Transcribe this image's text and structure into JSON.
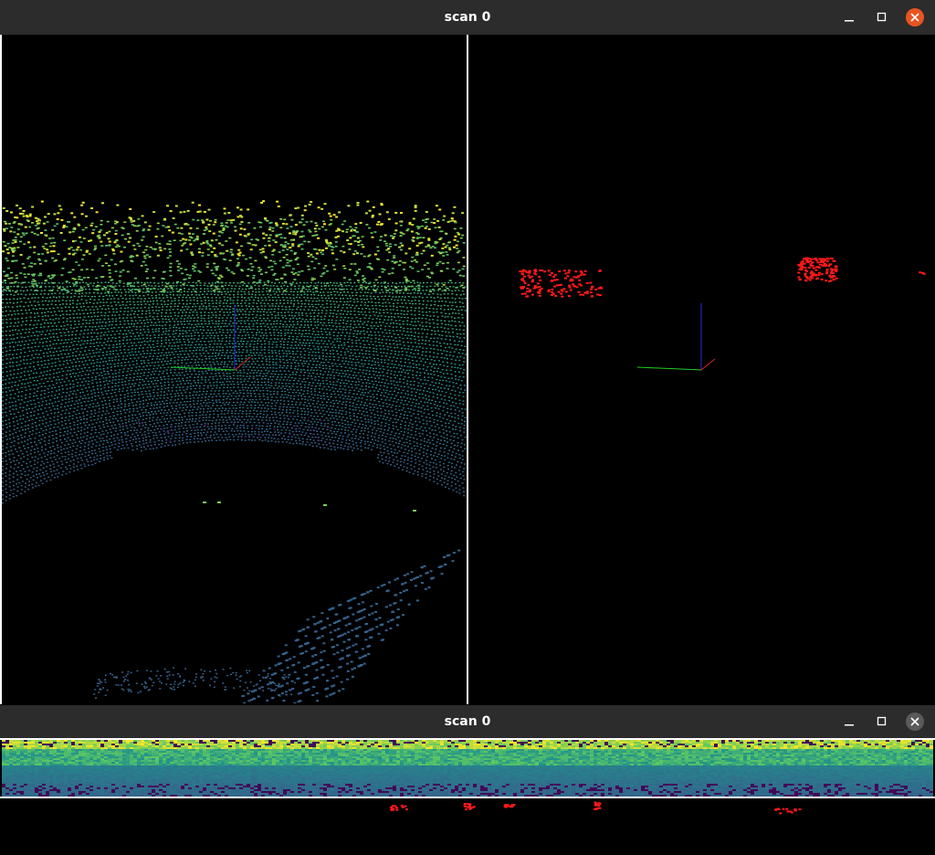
{
  "windows": [
    {
      "title": "scan 0",
      "controls": {
        "minimize": "minimize-icon",
        "maximize": "maximize-icon",
        "close": "close-icon"
      },
      "close_color": "#e95420",
      "views": {
        "left": "point-cloud-range-colored",
        "right": "point-cloud-label-colored"
      }
    },
    {
      "title": "scan 0",
      "controls": {
        "minimize": "minimize-icon",
        "maximize": "maximize-icon",
        "close": "close-icon"
      },
      "close_color": "#5a5a5a",
      "views": {
        "top": "range-image",
        "bottom": "label-image"
      }
    }
  ],
  "colors": {
    "titlebar": "#2c2c2c",
    "title_text": "#ffffff",
    "separator": "#ffffff",
    "label_red": "#ff1a1a",
    "axis_x": "#e02020",
    "axis_y": "#20d020",
    "axis_z": "#2030e0",
    "viridis": [
      "#440154",
      "#3b528b",
      "#21918c",
      "#5ec962",
      "#fde725"
    ]
  }
}
